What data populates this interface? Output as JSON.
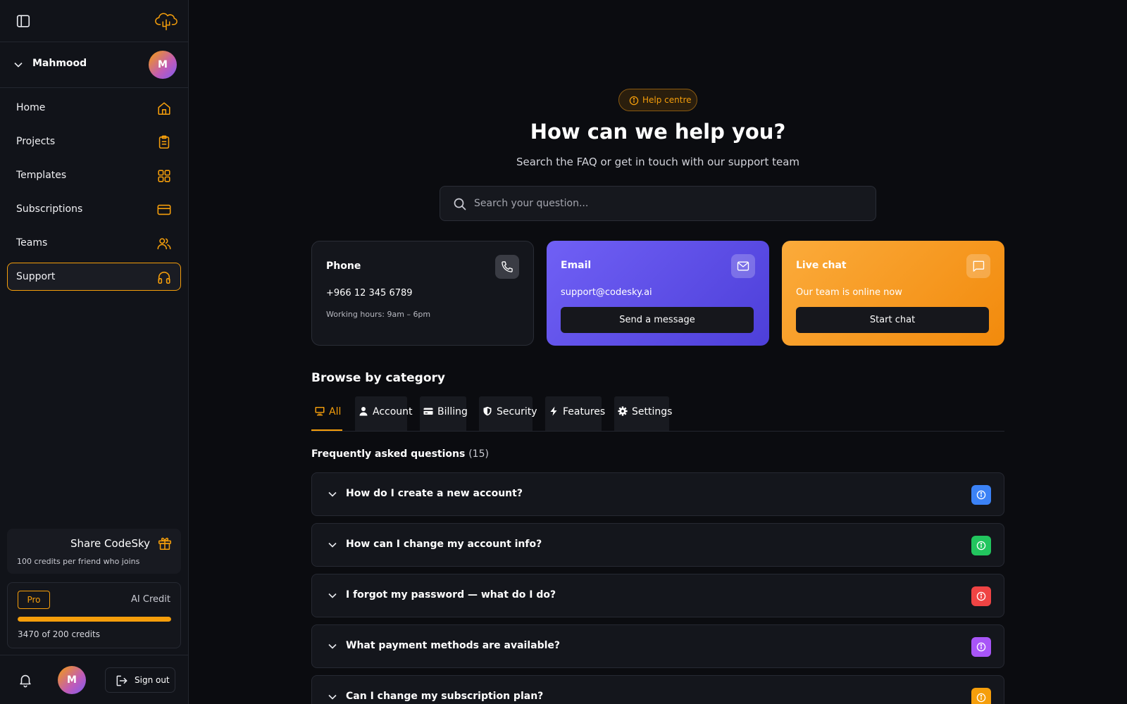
{
  "user": {
    "name": "Mahmood",
    "initial": "M"
  },
  "nav": [
    {
      "label": "Home",
      "icon": "home-icon"
    },
    {
      "label": "Projects",
      "icon": "clipboard-icon"
    },
    {
      "label": "Templates",
      "icon": "grid-icon"
    },
    {
      "label": "Subscriptions",
      "icon": "credit-card-icon"
    },
    {
      "label": "Teams",
      "icon": "users-icon"
    },
    {
      "label": "Support",
      "icon": "headphones-icon",
      "active": true
    }
  ],
  "share": {
    "title": "Share CodeSky",
    "subtitle": "100 credits per friend who joins"
  },
  "credits": {
    "plan": "Pro",
    "label": "AI Credit",
    "progress": 1.0,
    "text": "3470 of 200 credits"
  },
  "footer": {
    "signout": "Sign out"
  },
  "hero": {
    "pill": "Help centre",
    "title": "How can we help you?",
    "subtitle": "Search the FAQ or get in touch with our support team"
  },
  "search": {
    "placeholder": "Search your question..."
  },
  "contact": {
    "phone": {
      "title": "Phone",
      "value": "+966 12 345 6789",
      "hours": "Working hours: 9am – 6pm"
    },
    "email": {
      "title": "Email",
      "value": "support@codesky.ai",
      "button": "Send a message"
    },
    "chat": {
      "title": "Live chat",
      "value": "Our team is online now",
      "button": "Start chat"
    }
  },
  "browse": {
    "title": "Browse by category",
    "tabs": [
      {
        "label": "All",
        "icon": "monitor-icon",
        "active": true
      },
      {
        "label": "Account",
        "icon": "user-icon"
      },
      {
        "label": "Billing",
        "icon": "credit-card-icon"
      },
      {
        "label": "Security",
        "icon": "shield-icon"
      },
      {
        "label": "Features",
        "icon": "bolt-icon"
      },
      {
        "label": "Settings",
        "icon": "gear-icon"
      }
    ]
  },
  "faq": {
    "title": "Frequently asked questions",
    "count": "(15)",
    "items": [
      {
        "q": "How do I create a new account?",
        "color": "#3b82f6"
      },
      {
        "q": "How can I change my account info?",
        "color": "#22c55e"
      },
      {
        "q": "I forgot my password — what do I do?",
        "color": "#ef4444"
      },
      {
        "q": "What payment methods are available?",
        "color": "#a855f7"
      },
      {
        "q": "Can I change my subscription plan?",
        "color": "#f59e0b"
      }
    ]
  },
  "colors": {
    "accent": "#f59e0b",
    "background": "#0b0c10",
    "sidebar": "#111319"
  }
}
